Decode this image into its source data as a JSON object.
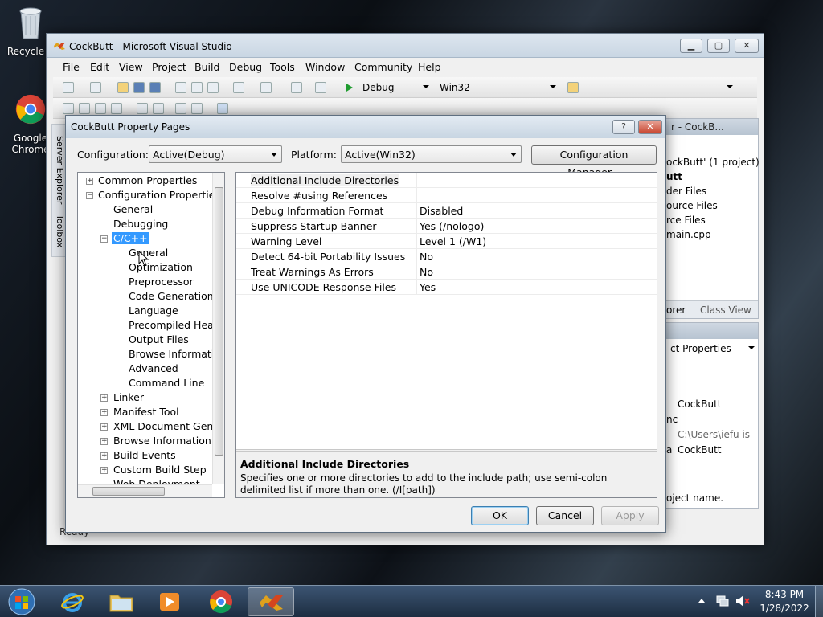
{
  "desktop": {
    "recycle_bin": "Recycle B",
    "chrome": "Google Chrome"
  },
  "vs": {
    "title": "CockButt - Microsoft Visual Studio",
    "menu": [
      "File",
      "Edit",
      "View",
      "Project",
      "Build",
      "Debug",
      "Tools",
      "Window",
      "Community",
      "Help"
    ],
    "toolbar": {
      "config": "Debug",
      "platform": "Win32",
      "find": ""
    },
    "side_tabs": [
      "Server Explorer",
      "Toolbox"
    ],
    "solution_panel": {
      "title": "r - CockB...",
      "items": [
        "ockButt' (1 project)",
        "utt",
        "der Files",
        "ource Files",
        "rce Files",
        "main.cpp"
      ],
      "tab_explorer": "orer",
      "tab_class_view": "Class View"
    },
    "properties_panel": {
      "combo": "ct Properties",
      "rows": [
        {
          "n": "",
          "v": "CockButt"
        },
        {
          "n": "nc",
          "v": "C:\\Users\\iefu is"
        },
        {
          "n": "a",
          "v": "CockButt"
        }
      ],
      "desc": "oject name."
    },
    "status": "Ready"
  },
  "dialog": {
    "title": "CockButt Property Pages",
    "help": "?",
    "config_label": "Configuration:",
    "config_value": "Active(Debug)",
    "platform_label": "Platform:",
    "platform_value": "Active(Win32)",
    "config_manager": "Configuration Manager...",
    "tree": {
      "common": "Common Properties",
      "config": "Configuration Properties",
      "general": "General",
      "debugging": "Debugging",
      "cpp": "C/C++",
      "cpp_children": [
        "General",
        "Optimization",
        "Preprocessor",
        "Code Generation",
        "Language",
        "Precompiled Heade",
        "Output Files",
        "Browse Information",
        "Advanced",
        "Command Line"
      ],
      "after": [
        "Linker",
        "Manifest Tool",
        "XML Document Genera",
        "Browse Information",
        "Build Events",
        "Custom Build Step",
        "Web Deployment"
      ]
    },
    "grid": [
      {
        "name": "Additional Include Directories",
        "value": ""
      },
      {
        "name": "Resolve #using References",
        "value": ""
      },
      {
        "name": "Debug Information Format",
        "value": "Disabled"
      },
      {
        "name": "Suppress Startup Banner",
        "value": "Yes (/nologo)"
      },
      {
        "name": "Warning Level",
        "value": "Level 1 (/W1)"
      },
      {
        "name": "Detect 64-bit Portability Issues",
        "value": "No"
      },
      {
        "name": "Treat Warnings As Errors",
        "value": "No"
      },
      {
        "name": "Use UNICODE Response Files",
        "value": "Yes"
      }
    ],
    "desc_title": "Additional Include Directories",
    "desc_text": "Specifies one or more directories to add to the include path; use semi-colon delimited list if more than one.     (/I[path])",
    "ok": "OK",
    "cancel": "Cancel",
    "apply": "Apply"
  },
  "taskbar": {
    "time": "8:43 PM",
    "date": "1/28/2022"
  }
}
